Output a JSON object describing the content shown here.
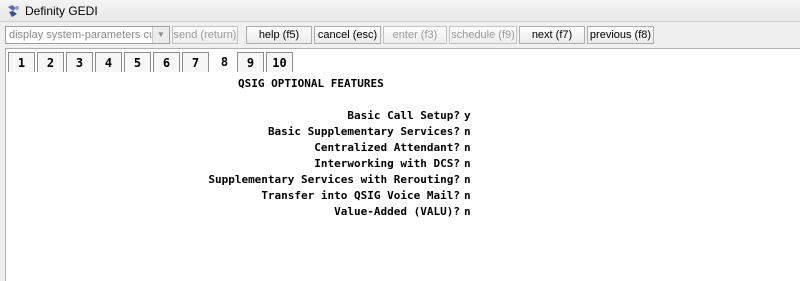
{
  "window": {
    "title": "Definity GEDI"
  },
  "toolbar": {
    "command_value": "display system-parameters custo",
    "buttons": {
      "send": "send (return)",
      "help": "help (f5)",
      "cancel": "cancel (esc)",
      "enter": "enter (f3)",
      "schedule": "schedule (f9)",
      "next": "next (f7)",
      "previous": "previous (f8)"
    }
  },
  "tabs": [
    "1",
    "2",
    "3",
    "4",
    "5",
    "6",
    "7",
    "8",
    "9",
    "10"
  ],
  "active_tab": "8",
  "screen": {
    "title": "QSIG OPTIONAL FEATURES",
    "fields": [
      {
        "label": "Basic Call Setup?",
        "value": "y"
      },
      {
        "label": "Basic Supplementary Services?",
        "value": "n"
      },
      {
        "label": "Centralized Attendant?",
        "value": "n"
      },
      {
        "label": "Interworking with DCS?",
        "value": "n"
      },
      {
        "label": "Supplementary Services with Rerouting?",
        "value": "n"
      },
      {
        "label": "Transfer into QSIG Voice Mail?",
        "value": "n"
      },
      {
        "label": "Value-Added (VALU)?",
        "value": "n"
      }
    ]
  }
}
